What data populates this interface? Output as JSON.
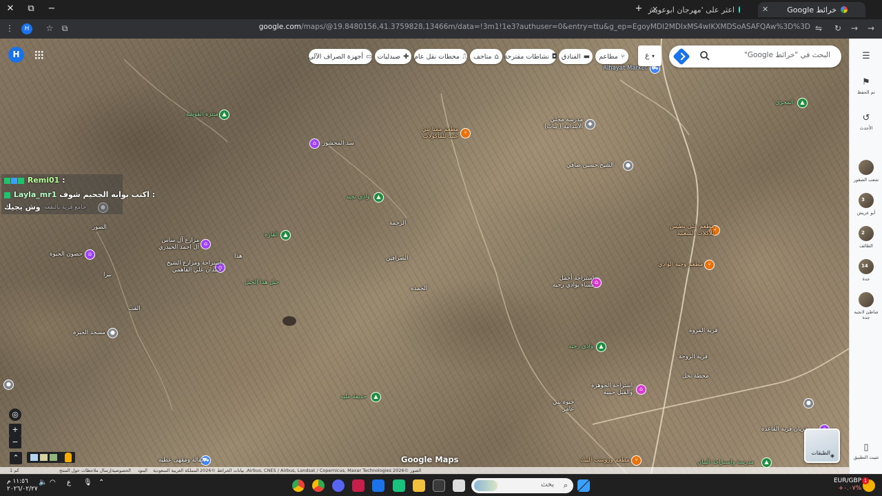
{
  "browser": {
    "tabs": [
      {
        "title": "خرائط Google",
        "active": true
      },
      {
        "title": "اعثر على 'مهرجان ابوعويش' على...",
        "active": false
      }
    ],
    "url_host": "google.com",
    "url_path": "/maps/@19.8480156,41.3759828,13466m/data=!3m1!1e3?authuser=0&entry=ttu&g_ep=EgoyMDI2MDIxMS4wIKXMDSoASAFQAw%3D%3D",
    "avatar_letter": "H"
  },
  "maps": {
    "search_placeholder": "البحث في \"خرائط Google\"",
    "avatar_letter": "H",
    "chips": [
      {
        "label": "مطاعم",
        "icon": "restaurant-icon"
      },
      {
        "label": "الفنادق",
        "icon": "hotel-icon"
      },
      {
        "label": "نشاطات مقترحة",
        "icon": "camera-icon"
      },
      {
        "label": "متاحف",
        "icon": "museum-icon"
      },
      {
        "label": "محطات نقل عام",
        "icon": "transit-icon"
      },
      {
        "label": "صيدليات",
        "icon": "pharmacy-icon"
      },
      {
        "label": "أجهزة الصراف الآلي",
        "icon": "atm-icon"
      }
    ],
    "chip_more": "ع",
    "places": [
      {
        "name": "Alhayat Market",
        "type": "blue"
      },
      {
        "name": "المجزئ",
        "type": "green"
      },
      {
        "name": "منتزه الفوشة",
        "type": "green"
      },
      {
        "name": "مطعم ممنا بني\nعبيد للمأكولات",
        "type": "orange"
      },
      {
        "name": "مدرسة مجلي\nالابتدائية ( بنات)",
        "type": "gray"
      },
      {
        "name": "سد المحشور",
        "type": "purple"
      },
      {
        "name": "الشيخ حسين صافي",
        "type": "gray"
      },
      {
        "name": "وادي نجيه",
        "type": "green"
      },
      {
        "name": "القارة",
        "type": "green"
      },
      {
        "name": "مطعم على نطيس\nللأكلات الشعبية",
        "type": "orange"
      },
      {
        "name": "مطعم وجبة الوادي",
        "type": "orange"
      },
      {
        "name": "مزارع آل ساس\nآل احمد الحيدري",
        "type": "purple"
      },
      {
        "name": "حصون الحبوة",
        "type": "purple"
      },
      {
        "name": "استراحة ومزارع الشيخ\nحمدان علي الفاهمي",
        "type": "purple"
      },
      {
        "name": "جبل هدا الحبل",
        "type": "green"
      },
      {
        "name": "استراحة أجمل\nمساء بوادي رحبه",
        "type": "pink"
      },
      {
        "name": "مسجد الحبرة",
        "type": "gray"
      },
      {
        "name": "وادي رحبه",
        "type": "green"
      },
      {
        "name": "حديقة ملبه",
        "type": "green"
      },
      {
        "name": "استراحة الجوهرة\nوالقبل حبيبة",
        "type": "pink"
      },
      {
        "name": "جامع قرية بالنقعه",
        "type": "gray"
      },
      {
        "name": "بقالة ومقهى عطيه",
        "type": "blue"
      },
      {
        "name": "مطعم وروست البيك",
        "type": "orange"
      },
      {
        "name": "مدرسة واستراحة البيان",
        "type": "green"
      },
      {
        "name": "خريان قرية القاعده",
        "type": "purple"
      }
    ],
    "area_labels": [
      "الرخمة",
      "الحمدة",
      "الصرافين",
      "قرية المروة",
      "قرية الروحة",
      "محطة نخل",
      "خبوة بني\nعامر",
      "الصور",
      "نيرا",
      "القب",
      "هذا",
      "الحمدة"
    ],
    "logo": "Google Maps",
    "attribution": "الصور ©2026 Airbus, CNES / Airbus, Landsat / Copernicus, Maxar Technologies, بيانات الخرائط ©2026",
    "attrib_links": [
      "المملكة العربية السعودية",
      "البنود",
      "الخصوصية",
      "إرسال ملاحظات حول المنتج"
    ],
    "scale": "1 كم",
    "layers_label": "الطبقات"
  },
  "chat": {
    "line1_name": "Remi01",
    "line1_text": ":",
    "line2_name": "Layla_mr1",
    "line2_text": "اكتب بوابه الجحيم شوف :",
    "line3_text": "وش يجيك"
  },
  "right_panel": [
    {
      "label": "تم الحفظ",
      "icon": "bookmark-icon"
    },
    {
      "label": "الأحدث",
      "icon": "history-icon"
    },
    {
      "label": "شعب الصقور",
      "thumb": ""
    },
    {
      "label": "أبو عريش",
      "thumb": "3"
    },
    {
      "label": "الطائف",
      "thumb": "2"
    },
    {
      "label": "جدة",
      "thumb": "14"
    },
    {
      "label": "شاطئ لانجيه\nجدة",
      "thumb": ""
    },
    {
      "label": "تثبيت التطبيق",
      "icon": "install-icon"
    }
  ],
  "taskbar": {
    "search_placeholder": "بحث",
    "clock_time": "١١:٥٦ م",
    "clock_date": "٢٠٢٦/٠٢/٢٧",
    "lang": "ع",
    "fx_pair": "EUR/GBP",
    "fx_change": "+٠.٠٧%",
    "notification_count": "1"
  }
}
